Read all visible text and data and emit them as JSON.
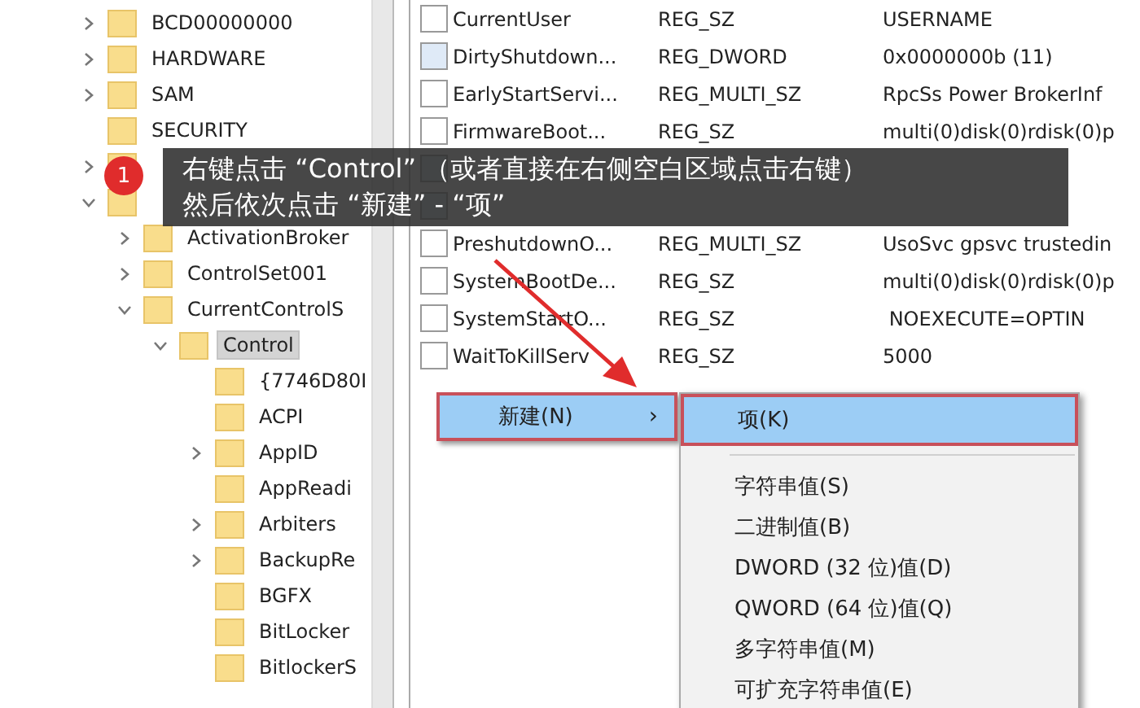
{
  "tree": [
    {
      "kind": "branch",
      "label": "BCD00000000",
      "expanded": false,
      "selected": false
    },
    {
      "kind": "branch",
      "label": "HARDWARE",
      "expanded": false,
      "selected": false
    },
    {
      "kind": "branch",
      "label": "SAM",
      "expanded": false,
      "selected": false
    },
    {
      "kind": "leaf",
      "label": "SECURITY",
      "selected": false
    },
    {
      "kind": "branch",
      "expanded": false
    },
    {
      "kind": "branch",
      "expanded": true,
      "children": [
        {
          "kind": "branch",
          "label": "ActivationBroker",
          "expanded": false,
          "selected": false
        },
        {
          "kind": "branch",
          "label": "ControlSet001",
          "expanded": false,
          "selected": false
        },
        {
          "kind": "branch",
          "label": "CurrentControlS",
          "expanded": true,
          "selected": false,
          "children": [
            {
              "kind": "branch",
              "label": "Control",
              "expanded": true,
              "selected": true,
              "children": [
                {
                  "kind": "leaf",
                  "label": "{7746D80I",
                  "selected": false
                },
                {
                  "kind": "leaf",
                  "label": "ACPI",
                  "selected": false
                },
                {
                  "kind": "branch",
                  "label": "AppID",
                  "expanded": false,
                  "selected": false
                },
                {
                  "kind": "leaf",
                  "label": "AppReadi",
                  "selected": false
                },
                {
                  "kind": "branch",
                  "label": "Arbiters",
                  "expanded": false,
                  "selected": false
                },
                {
                  "kind": "branch",
                  "label": "BackupRe",
                  "expanded": false,
                  "selected": false
                },
                {
                  "kind": "leaf",
                  "label": "BGFX",
                  "selected": false
                },
                {
                  "kind": "leaf",
                  "label": "BitLocker",
                  "selected": false
                },
                {
                  "kind": "leaf",
                  "label": "BitlockerS",
                  "selected": false
                }
              ]
            }
          ]
        }
      ]
    }
  ],
  "values": [
    {
      "kind": "string",
      "name": "CurrentUser",
      "type": "REG_SZ",
      "data": "USERNAME"
    },
    {
      "kind": "number",
      "name": "DirtyShutdown...",
      "type": "REG_DWORD",
      "data": "0x0000000b (11)"
    },
    {
      "kind": "string",
      "name": "EarlyStartServi...",
      "type": "REG_MULTI_SZ",
      "data": "RpcSs Power BrokerInf"
    },
    {
      "kind": "string",
      "name": "FirmwareBoot...",
      "type": "REG_SZ",
      "data": "multi(0)disk(0)rdisk(0)p"
    },
    {
      "kind": "number"
    },
    {
      "kind": "number"
    },
    {
      "kind": "string",
      "name": "PreshutdownO...",
      "type": "REG_MULTI_SZ",
      "data": "UsoSvc gpsvc trustedin"
    },
    {
      "kind": "string",
      "name": "SystemBootDe...",
      "type": "REG_SZ",
      "data": "multi(0)disk(0)rdisk(0)p"
    },
    {
      "kind": "string",
      "name": "SystemStartO...",
      "type": "REG_SZ",
      "data": " NOEXECUTE=OPTIN"
    },
    {
      "kind": "string",
      "name": "WaitToKillServ",
      "type": "REG_SZ",
      "data": "5000"
    }
  ],
  "context_menu": {
    "label": "新建(N)",
    "arrow": "›",
    "selected": true
  },
  "submenu": [
    {
      "kind": "item",
      "label": "项(K)",
      "selected": true
    },
    {
      "kind": "separator"
    },
    {
      "kind": "item",
      "label": "字符串值(S)",
      "selected": false
    },
    {
      "kind": "item",
      "label": "二进制值(B)",
      "selected": false
    },
    {
      "kind": "item",
      "label": "DWORD (32 位)值(D)",
      "selected": false
    },
    {
      "kind": "item",
      "label": "QWORD (64 位)值(Q)",
      "selected": false
    },
    {
      "kind": "item",
      "label": "多字符串值(M)",
      "selected": false
    },
    {
      "kind": "item",
      "label": "可扩充字符串值(E)",
      "selected": false
    }
  ],
  "callout": {
    "step": "1",
    "lines": [
      "右键点击 “Control”  （或者直接在右侧空白区域点击右键）",
      "然后依次点击 “新建” - “项”"
    ]
  }
}
